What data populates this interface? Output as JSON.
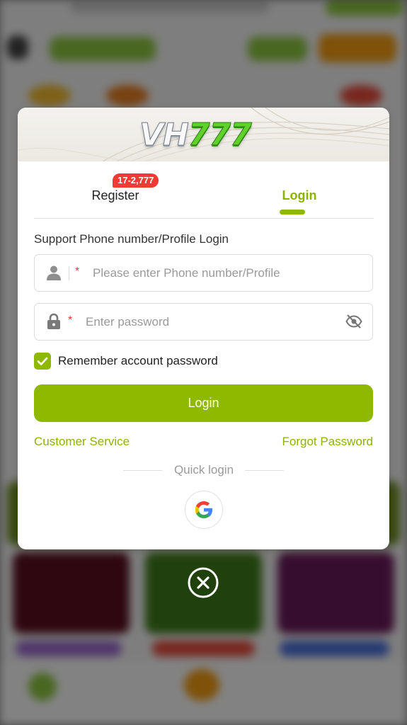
{
  "brand": {
    "logo_letters": "VH",
    "logo_digits": "777"
  },
  "tabs": {
    "register_label": "Register",
    "register_badge": "17-2,777",
    "login_label": "Login",
    "active": "login"
  },
  "form": {
    "support_label": "Support Phone number/Profile Login",
    "phone": {
      "placeholder": "Please enter Phone number/Profile",
      "value": "",
      "required_mark": "*",
      "icon": "user-icon"
    },
    "password": {
      "placeholder": "Enter password",
      "value": "",
      "required_mark": "*",
      "icon": "lock-icon",
      "toggle_icon": "eye-off-icon"
    },
    "remember": {
      "label": "Remember account password",
      "checked": true
    },
    "submit_label": "Login"
  },
  "links": {
    "customer_service": "Customer Service",
    "forgot_password": "Forgot Password"
  },
  "quick_login": {
    "label": "Quick login",
    "providers": [
      "google-icon"
    ]
  },
  "close_icon": "close-circle-icon",
  "colors": {
    "accent": "#8fb900",
    "badge": "#ef3b34",
    "required": "#e53935"
  }
}
